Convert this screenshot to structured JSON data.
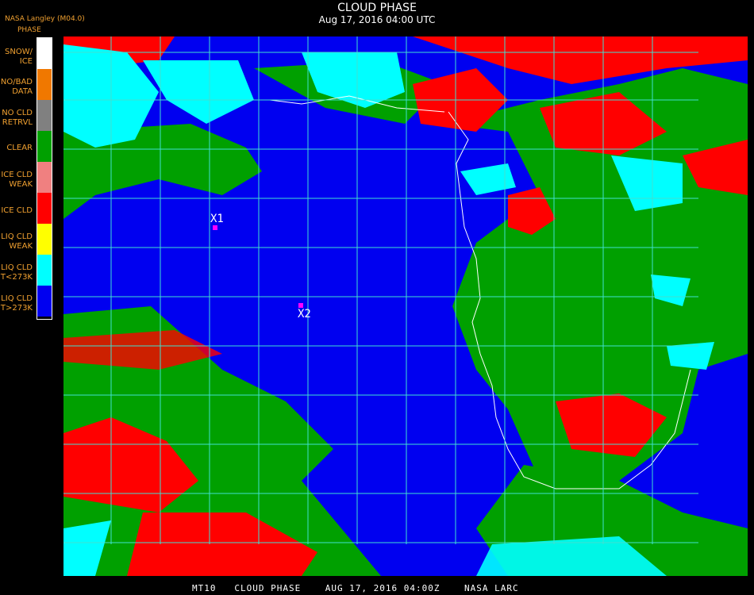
{
  "header": {
    "title": "CLOUD PHASE",
    "subtitle": "Aug 17, 2016 04:00 UTC",
    "source": "NASA Langley (M04.0)",
    "legend_title": "PHASE"
  },
  "legend": {
    "items": [
      {
        "label": "SNOW/\nICE",
        "color": "#ffffff"
      },
      {
        "label": "NO/BAD\nDATA",
        "color": "#f07800"
      },
      {
        "label": "NO CLD\nRETRVL",
        "color": "#808080"
      },
      {
        "label": "CLEAR",
        "color": "#00a000"
      },
      {
        "label": "ICE CLD\nWEAK",
        "color": "#f08080"
      },
      {
        "label": "ICE CLD",
        "color": "#ff0000"
      },
      {
        "label": "LIQ CLD\nWEAK",
        "color": "#ffff00"
      },
      {
        "label": "LIQ CLD\nT<273K",
        "color": "#00ffff"
      },
      {
        "label": "LIQ CLD\nT>273K",
        "color": "#0000f0"
      }
    ]
  },
  "markers": [
    {
      "label": "X1"
    },
    {
      "label": "X2"
    }
  ],
  "footer": "MT10   CLOUD PHASE    AUG 17, 2016 04:00Z    NASA LARC"
}
